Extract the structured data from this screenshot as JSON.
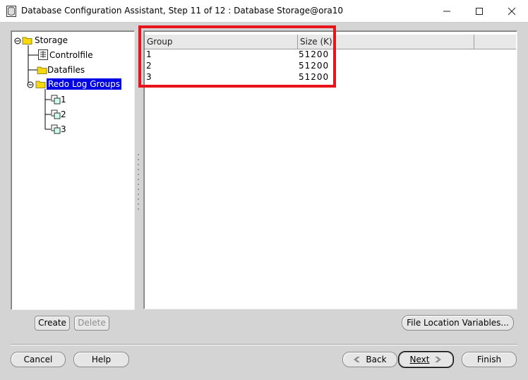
{
  "window": {
    "title": "Database Configuration Assistant, Step 11 of 12 : Database Storage@ora10",
    "minimize_icon": "minimize-icon",
    "maximize_icon": "maximize-icon",
    "close_icon": "close-icon"
  },
  "tree": {
    "root": "Storage",
    "items": [
      {
        "label": "Controlfile",
        "icon": "controlfile-icon"
      },
      {
        "label": "Datafiles",
        "icon": "folder-icon"
      },
      {
        "label": "Redo Log Groups",
        "icon": "folder-icon",
        "selected": true
      }
    ],
    "redo_children": [
      "1",
      "2",
      "3"
    ]
  },
  "table": {
    "columns": [
      "Group",
      "Size (K)"
    ],
    "rows": [
      {
        "group": "1",
        "size": "51200"
      },
      {
        "group": "2",
        "size": "51200"
      },
      {
        "group": "3",
        "size": "51200"
      }
    ]
  },
  "buttons": {
    "create": "Create",
    "delete": "Delete",
    "file_location": "File Location Variables...",
    "cancel": "Cancel",
    "help": "Help",
    "back": "Back",
    "next": "Next",
    "finish": "Finish"
  },
  "colors": {
    "selection": "#0000e6",
    "highlight_box": "#e8131b",
    "folder": "#f5d90a"
  }
}
